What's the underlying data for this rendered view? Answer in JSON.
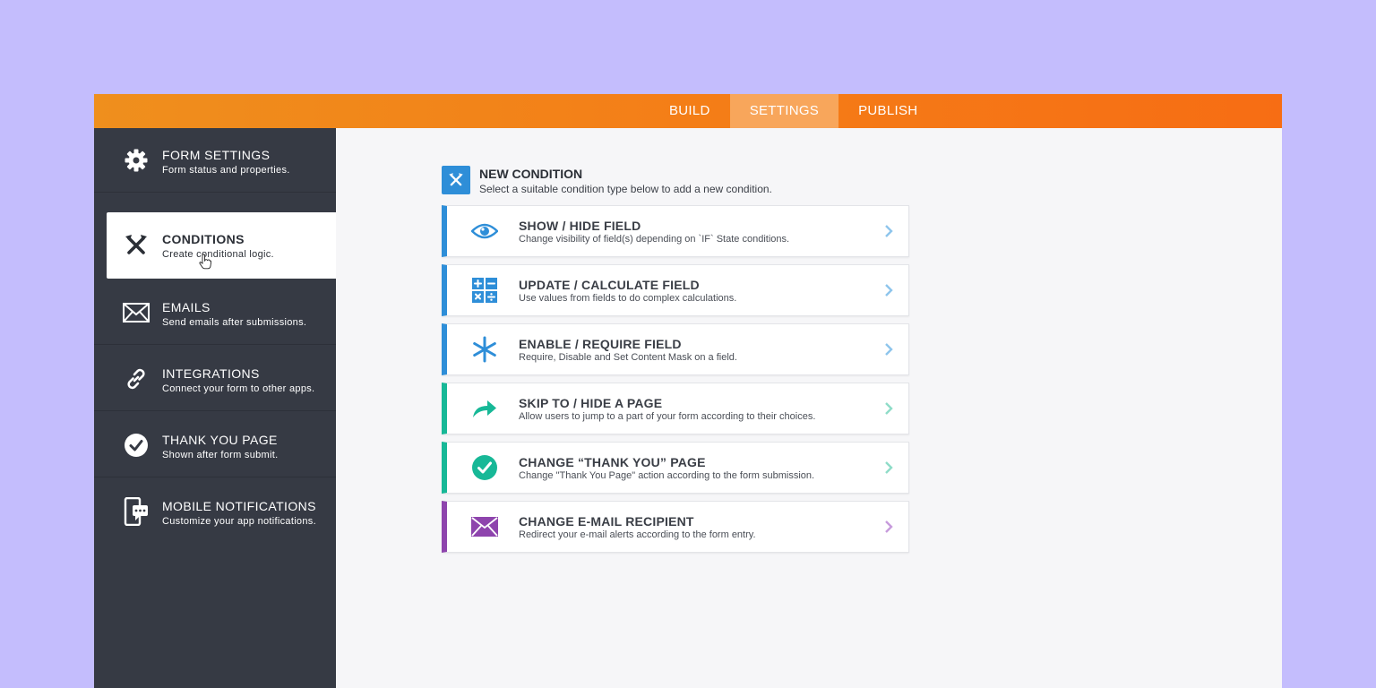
{
  "topnav": {
    "tabs": [
      {
        "label": "BUILD"
      },
      {
        "label": "SETTINGS",
        "active": true
      },
      {
        "label": "PUBLISH"
      }
    ]
  },
  "sidebar": {
    "items": [
      {
        "title": "FORM SETTINGS",
        "subtitle": "Form status and properties.",
        "icon": "gear-icon"
      },
      {
        "title": "CONDITIONS",
        "subtitle": "Create conditional logic.",
        "icon": "conditions-icon",
        "active": true
      },
      {
        "title": "EMAILS",
        "subtitle": "Send emails after submissions.",
        "icon": "envelope-icon"
      },
      {
        "title": "INTEGRATIONS",
        "subtitle": "Connect your form to other apps.",
        "icon": "link-icon"
      },
      {
        "title": "THANK YOU PAGE",
        "subtitle": "Shown after form submit.",
        "icon": "check-circle-icon"
      },
      {
        "title": "MOBILE NOTIFICATIONS",
        "subtitle": "Customize your app notifications.",
        "icon": "mobile-notification-icon"
      }
    ]
  },
  "main": {
    "header": {
      "title": "NEW CONDITION",
      "subtitle": "Select a suitable condition type below to add a new condition."
    },
    "cards": [
      {
        "title": "SHOW / HIDE FIELD",
        "subtitle": "Change visibility of field(s) depending on `IF` State conditions.",
        "icon": "eye-icon",
        "color": "#2e8ed8"
      },
      {
        "title": "UPDATE / CALCULATE FIELD",
        "subtitle": "Use values from fields to do complex calculations.",
        "icon": "calculator-icon",
        "color": "#2e8ed8"
      },
      {
        "title": "ENABLE / REQUIRE FIELD",
        "subtitle": "Require, Disable and Set Content Mask on a field.",
        "icon": "asterisk-icon",
        "color": "#2e8ed8"
      },
      {
        "title": "SKIP TO / HIDE A PAGE",
        "subtitle": "Allow users to jump to a part of your form according to their choices.",
        "icon": "arrow-forward-icon",
        "color": "#17b897"
      },
      {
        "title": "CHANGE “THANK YOU” PAGE",
        "subtitle": "Change \"Thank You Page\" action according to the form submission.",
        "icon": "check-circle-icon",
        "color": "#17b897"
      },
      {
        "title": "CHANGE E-MAIL RECIPIENT",
        "subtitle": "Redirect your e-mail alerts according to the form entry.",
        "icon": "envelope-icon",
        "color": "#8e44ad"
      }
    ]
  }
}
